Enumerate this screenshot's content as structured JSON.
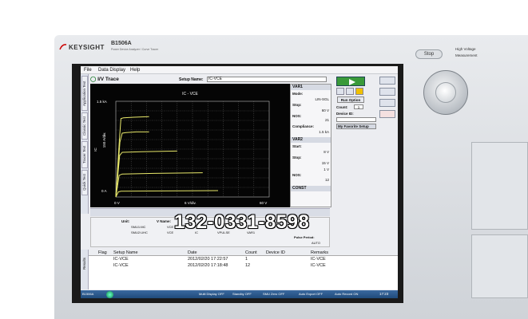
{
  "device": {
    "brand": "KEYSIGHT",
    "model": "B1506A",
    "model_subtitle": "Power Device Analyzer / Curve Tracer",
    "stop_label": "Stop",
    "hv_label": "High Voltage",
    "measurement_label": "Measurement"
  },
  "menu": [
    "File",
    "Data Display",
    "Help"
  ],
  "vtabs": [
    "Application Test",
    "Classic Test",
    "Tracer Test",
    "Quick Test"
  ],
  "trace": {
    "title": "I/V Trace",
    "setup_label": "Setup Name:",
    "setup_value": "IC-VCE"
  },
  "chart_data": {
    "type": "line",
    "title": "IC - VCE",
    "xlabel": "VCE",
    "ylabel": "IC",
    "x_ticks": [
      "0 V",
      "6 V/div.",
      "60 V"
    ],
    "y_ticks": [
      "1.5 kA",
      "0 A"
    ],
    "y_div_label": "150 A/div.",
    "xlim": [
      0,
      60
    ],
    "ylim": [
      0,
      1500
    ],
    "grid": true,
    "series": [
      {
        "values": [
          [
            0,
            0
          ],
          [
            1.4,
            900
          ],
          [
            2,
            1230
          ],
          [
            3,
            1240
          ],
          [
            7,
            1250
          ],
          [
            13,
            1260
          ]
        ]
      },
      {
        "values": [
          [
            0,
            0
          ],
          [
            1.6,
            860
          ],
          [
            2.5,
            1000
          ],
          [
            4,
            1010
          ],
          [
            8,
            1020
          ],
          [
            13,
            1020
          ]
        ]
      },
      {
        "values": [
          [
            0,
            0
          ],
          [
            1.5,
            650
          ],
          [
            2.5,
            700
          ],
          [
            10,
            710
          ],
          [
            24,
            720
          ]
        ]
      },
      {
        "values": [
          [
            0,
            0
          ],
          [
            1.3,
            340
          ],
          [
            2.5,
            360
          ],
          [
            15,
            370
          ],
          [
            34,
            380
          ]
        ]
      },
      {
        "values": [
          [
            0,
            0
          ],
          [
            1,
            80
          ],
          [
            2,
            90
          ],
          [
            20,
            95
          ],
          [
            40,
            100
          ]
        ]
      }
    ]
  },
  "var1": {
    "title": "VAR1",
    "mode_label": "Mode:",
    "mode_value": "LIN-SGL",
    "stop_label": "Stop:",
    "stop_value": "60 V",
    "nos_label": "NOS:",
    "nos_value": "21",
    "compliance_label": "Compliance:",
    "compliance_value": "1.5 kA"
  },
  "var2": {
    "title": "VAR2",
    "start_label": "Start:",
    "start_value": "8 V",
    "stop_label": "Stop:",
    "stop_value": "15 V",
    "step_value": "1 V",
    "nos_label": "NOS:",
    "nos_value": "12"
  },
  "const_label": "CONST",
  "run": {
    "run_option": "Run Option",
    "count_label": "Count:",
    "count_value": "1",
    "device_id_label": "Device ID:",
    "favorite": "My Favorite Setup"
  },
  "units": {
    "unit_label": "Unit:",
    "vname_label": "V Name:",
    "smu1": "SMU1:MC",
    "smu2": "SMU2:UHC",
    "vce": "VCE",
    "ic": "IC",
    "vpulse": "VPULSE",
    "var1": "VAR1",
    "pulse_period_label": "Pulse Period:",
    "pulse_period_value": "AUTO"
  },
  "results": {
    "side_label": "Results",
    "columns": [
      "Flag",
      "Setup Name",
      "Date",
      "Count",
      "Device ID",
      "Remarks"
    ],
    "rows": [
      [
        "",
        "IC-VCE",
        "2012/02/20 17:22:57",
        "1",
        "",
        "IC-VCE"
      ],
      [
        "",
        "IC-VCE",
        "2012/02/20 17:18:48",
        "12",
        "",
        "IC-VCE"
      ]
    ]
  },
  "taskbar": {
    "app": "B1506A",
    "items": [
      "Multi Display OFF",
      "Standby OFF",
      "SMU Zero OFF",
      "Auto Export OFF",
      "Auto Record ON"
    ],
    "clock": "17:23"
  },
  "watermark": "132-0331-8598"
}
